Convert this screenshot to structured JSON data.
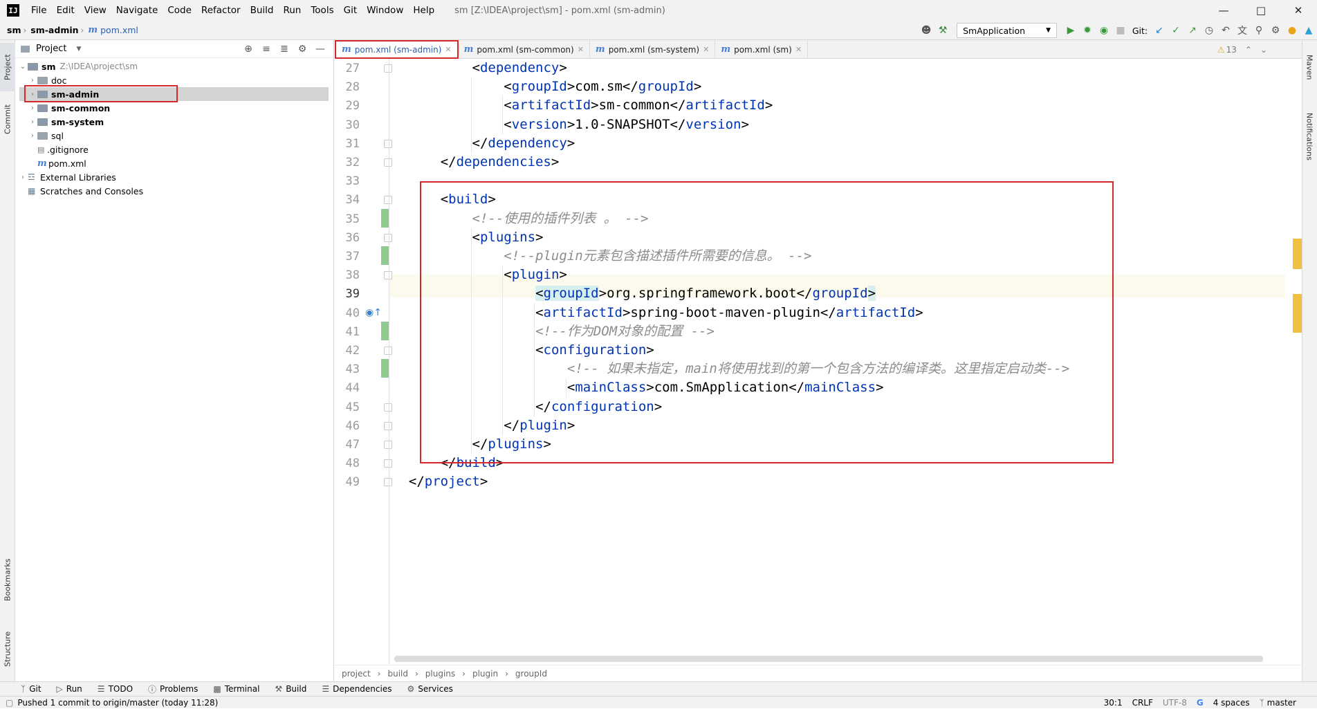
{
  "titlebar": {
    "menu": [
      "File",
      "Edit",
      "View",
      "Navigate",
      "Code",
      "Refactor",
      "Build",
      "Run",
      "Tools",
      "Git",
      "Window",
      "Help"
    ],
    "window_title": "sm [Z:\\IDEA\\project\\sm] - pom.xml (sm-admin)"
  },
  "navbar": {
    "crumbs": [
      "sm",
      "sm-admin",
      "pom.xml"
    ],
    "run_config": "SmApplication",
    "git_label": "Git:"
  },
  "left_strip": {
    "project": "Project",
    "commit": "Commit",
    "bookmarks": "Bookmarks",
    "structure": "Structure"
  },
  "right_strip": {
    "maven": "Maven",
    "notifications": "Notifications"
  },
  "project_panel": {
    "title": "Project",
    "root_name": "sm",
    "root_path": "Z:\\IDEA\\project\\sm",
    "items": [
      "doc",
      "sm-admin",
      "sm-common",
      "sm-system",
      "sql",
      ".gitignore",
      "pom.xml",
      "External Libraries",
      "Scratches and Consoles"
    ]
  },
  "tabs": [
    "pom.xml (sm-admin)",
    "pom.xml (sm-common)",
    "pom.xml (sm-system)",
    "pom.xml (sm)"
  ],
  "warnings": "13",
  "editor": {
    "line_numbers": [
      "27",
      "28",
      "29",
      "30",
      "31",
      "32",
      "33",
      "34",
      "35",
      "36",
      "37",
      "38",
      "39",
      "40",
      "41",
      "42",
      "43",
      "44",
      "45",
      "46",
      "47",
      "48",
      "49"
    ],
    "lines": [
      {
        "a": "<",
        "t": "dependency",
        "b": ">"
      },
      {
        "a": "<",
        "t": "groupId",
        "m": ">com.sm</",
        "t2": "groupId",
        "b": ">"
      },
      {
        "a": "<",
        "t": "artifactId",
        "m": ">sm-common</",
        "t2": "artifactId",
        "b": ">"
      },
      {
        "a": "<",
        "t": "version",
        "m": ">1.0-SNAPSHOT</",
        "t2": "version",
        "b": ">"
      },
      {
        "a": "</",
        "t": "dependency",
        "b": ">"
      },
      {
        "a": "</",
        "t": "dependencies",
        "b": ">"
      },
      {
        "c": ""
      },
      {
        "a": "<",
        "t": "build",
        "b": ">"
      },
      {
        "c": "<!--使用的插件列表 。 -->"
      },
      {
        "a": "<",
        "t": "plugins",
        "b": ">"
      },
      {
        "c": "<!--plugin元素包含描述插件所需要的信息。 -->"
      },
      {
        "a": "<",
        "t": "plugin",
        "b": ">"
      },
      {
        "a": "<",
        "t": "groupId",
        "m": ">org.springframework.boot</",
        "t2": "groupId",
        "b": ">"
      },
      {
        "a": "<",
        "t": "artifactId",
        "m": ">spring-boot-maven-plugin</",
        "t2": "artifactId",
        "b": ">"
      },
      {
        "c": "<!--作为DOM对象的配置 -->"
      },
      {
        "a": "<",
        "t": "configuration",
        "b": ">"
      },
      {
        "c": "<!-- 如果未指定，main将使用找到的第一个包含方法的编译类。这里指定启动类-->"
      },
      {
        "a": "<",
        "t": "mainClass",
        "m": ">com.SmApplication</",
        "t2": "mainClass",
        "b": ">"
      },
      {
        "a": "</",
        "t": "configuration",
        "b": ">"
      },
      {
        "a": "</",
        "t": "plugin",
        "b": ">"
      },
      {
        "a": "</",
        "t": "plugins",
        "b": ">"
      },
      {
        "a": "</",
        "t": "build",
        "b": ">"
      },
      {
        "a": "</",
        "t": "project",
        "b": ">"
      }
    ]
  },
  "code_breadcrumb": [
    "project",
    "build",
    "plugins",
    "plugin",
    "groupId"
  ],
  "bottom_tools": [
    "Git",
    "Run",
    "TODO",
    "Problems",
    "Terminal",
    "Build",
    "Dependencies",
    "Services"
  ],
  "status": {
    "message": "Pushed 1 commit to origin/master (today 11:28)",
    "position": "30:1",
    "line_sep": "CRLF",
    "encoding": "UTF-8",
    "indent": "4 spaces",
    "branch": "master"
  }
}
